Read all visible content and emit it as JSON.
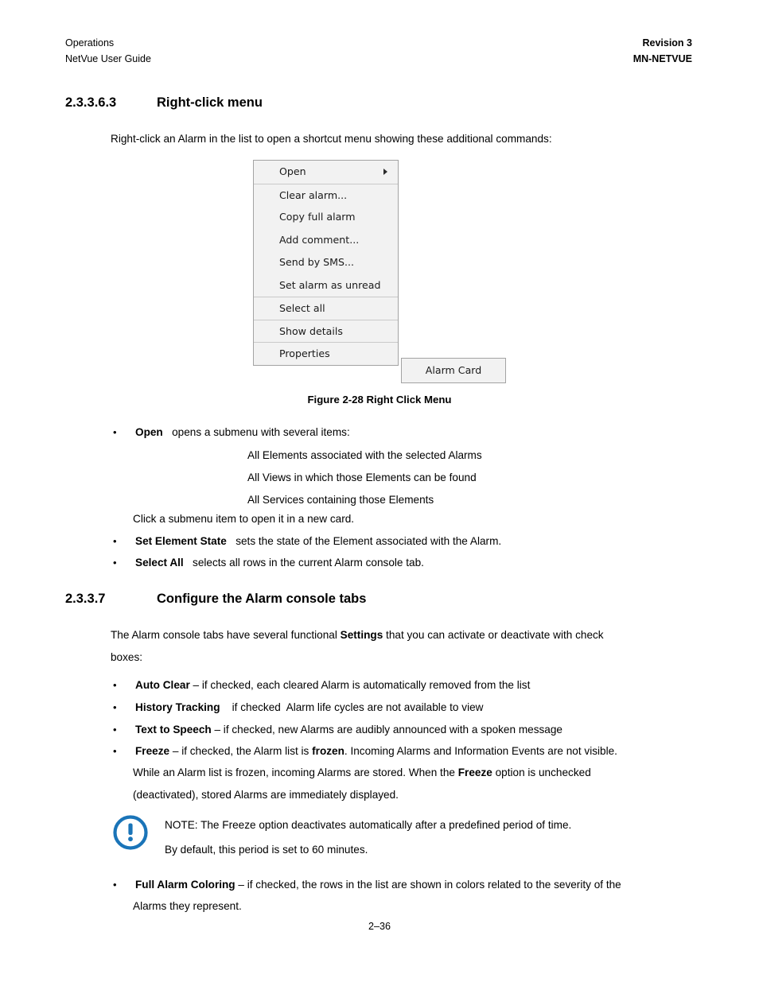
{
  "header": {
    "left_line1": "Operations",
    "left_line2": "NetVue User Guide",
    "right_line1": "Revision 3",
    "right_line2": "MN-NETVUE"
  },
  "section_rightclick": {
    "number": "2.3.3.6.3",
    "title": "Right-click menu",
    "intro": "Right-click an Alarm in the list to open a shortcut menu showing these additional commands:"
  },
  "context_menu": {
    "items": [
      {
        "label": "Open",
        "has_submenu": true,
        "separator_after": true
      },
      {
        "label": "Clear alarm...",
        "has_submenu": false,
        "separator_after": false
      },
      {
        "label": "Copy full alarm",
        "has_submenu": false,
        "separator_after": false
      },
      {
        "label": "Add comment...",
        "has_submenu": false,
        "separator_after": false
      },
      {
        "label": "Send by SMS...",
        "has_submenu": false,
        "separator_after": false
      },
      {
        "label": "Set alarm as unread",
        "has_submenu": false,
        "separator_after": true
      },
      {
        "label": "Select all",
        "has_submenu": false,
        "separator_after": true
      },
      {
        "label": "Show details",
        "has_submenu": false,
        "separator_after": true
      },
      {
        "label": "Properties",
        "has_submenu": false,
        "separator_after": false
      }
    ],
    "submenu_label": "Alarm Card",
    "arrow_icon": "triangle-right-icon",
    "background": "#f2f2f2",
    "border_color": "#a3a3a3"
  },
  "figure": {
    "caption": "Figure 2-28 Right Click Menu"
  },
  "open_bullet": {
    "label": "Open",
    "text": "opens a submenu with several items:",
    "sub_items": [
      "All Elements associated with the selected Alarms",
      "All Views in which those Elements can be found",
      "All Services containing those Elements"
    ],
    "closing": "Click a submenu item to open it in a new card."
  },
  "command_bullets": [
    {
      "label": "Set Element State",
      "text": "sets the state of the Element associated with the Alarm."
    },
    {
      "label": "Select All",
      "text": "selects all rows in the current Alarm console tab."
    }
  ],
  "section_configure": {
    "number": "2.3.3.7",
    "title": "Configure the Alarm console tabs",
    "intro_a": "The Alarm console tabs have several functional ",
    "intro_bold": "Settings",
    "intro_b": " that you can activate or deactivate with check",
    "intro_line2": "boxes:"
  },
  "settings_bullets": [
    {
      "label": "Auto Clear",
      "text": " – if checked, each cleared Alarm is automatically removed from the list"
    },
    {
      "label": "History Tracking",
      "text": "    if checked  Alarm life cycles are not available to view"
    },
    {
      "label": "Text to Speech",
      "text": " – if checked, new Alarms are audibly announced with a spoken message"
    }
  ],
  "freeze_bullet": {
    "label": "Freeze",
    "line1_a": " – if checked, the Alarm list is ",
    "line1_bold": "frozen",
    "line1_b": ". Incoming Alarms and Information Events are not visible.",
    "line2_a": "While an Alarm list is frozen, incoming Alarms are stored. When the ",
    "line2_bold": "Freeze",
    "line2_b": " option is unchecked",
    "line3": "(deactivated), stored Alarms are immediately displayed."
  },
  "note": {
    "icon": "exclamation-circle-icon",
    "icon_color": "#1a74b8",
    "line1": "NOTE:  The Freeze option deactivates automatically after a predefined period of time.",
    "line2": "By default, this period is set to 60 minutes."
  },
  "full_alarm_coloring_bullet": {
    "label": "Full Alarm Coloring",
    "line1": " – if checked, the rows in the list are shown in colors related to the severity of the",
    "line2": "Alarms they represent."
  },
  "footer": {
    "page_number": "2–36"
  }
}
